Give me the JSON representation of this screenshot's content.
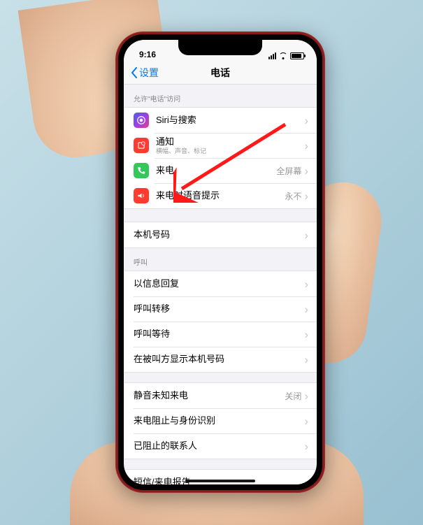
{
  "status": {
    "time": "9:16"
  },
  "nav": {
    "back": "设置",
    "title": "电话"
  },
  "section_allow_header": "允许\"电话\"访问",
  "rows": {
    "siri": {
      "label": "Siri与搜索"
    },
    "notifications": {
      "label": "通知",
      "sub": "横幅、声音、标记"
    },
    "incoming": {
      "label": "来电",
      "value": "全屏幕"
    },
    "announce": {
      "label": "来电时语音提示",
      "value": "永不"
    }
  },
  "my_number": {
    "label": "本机号码"
  },
  "section_calls_header": "呼叫",
  "calls": {
    "reply_msg": {
      "label": "以信息回复"
    },
    "call_fwd": {
      "label": "呼叫转移"
    },
    "call_wait": {
      "label": "呼叫等待"
    },
    "show_id": {
      "label": "在被叫方显示本机号码"
    }
  },
  "silence": {
    "label": "静音未知来电",
    "value": "关闭"
  },
  "block": {
    "label": "来电阻止与身份识别"
  },
  "blocked": {
    "label": "已阻止的联系人"
  },
  "sms_report": {
    "label": "短信/来电报告"
  },
  "icon_colors": {
    "siri": "#1a1a1a",
    "notifications": "#ff3b30",
    "incoming": "#34c759",
    "announce": "#ff3b30"
  }
}
